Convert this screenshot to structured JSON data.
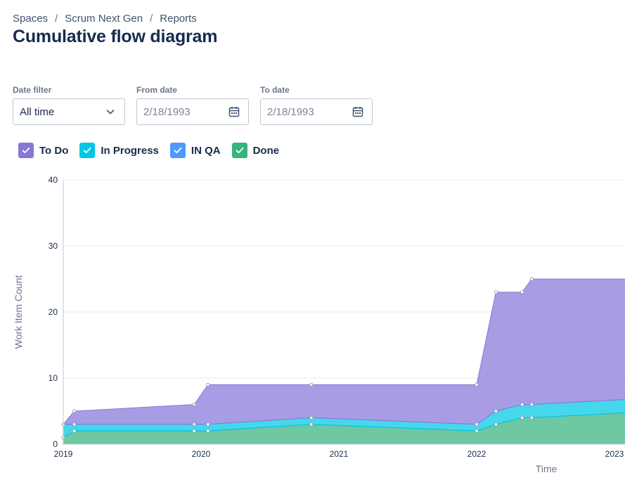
{
  "breadcrumb": {
    "items": [
      "Spaces",
      "Scrum Next Gen",
      "Reports"
    ],
    "separator": "/"
  },
  "page": {
    "title": "Cumulative flow diagram"
  },
  "filters": {
    "date_filter": {
      "label": "Date filter",
      "value": "All time"
    },
    "from_date": {
      "label": "From date",
      "value": "2/18/1993"
    },
    "to_date": {
      "label": "To date",
      "value": "2/18/1993"
    }
  },
  "legend": [
    {
      "label": "To Do",
      "color": "#8777d9",
      "checked": true
    },
    {
      "label": "In Progress",
      "color": "#00c7e6",
      "checked": true
    },
    {
      "label": "IN QA",
      "color": "#4c9aff",
      "checked": true
    },
    {
      "label": "Done",
      "color": "#36b37e",
      "checked": true
    }
  ],
  "chart_data": {
    "type": "area",
    "stacked": true,
    "xlabel": "Time",
    "ylabel": "Work Item Count",
    "ylim": [
      0,
      40
    ],
    "y_ticks": [
      0,
      10,
      20,
      30,
      40
    ],
    "x_ticks": [
      "2019",
      "2020",
      "2021",
      "2022",
      "2023"
    ],
    "grid": true,
    "x": [
      2019.0,
      2019.08,
      2019.95,
      2020.05,
      2020.8,
      2022.0,
      2022.14,
      2022.33,
      2022.4,
      2023.3
    ],
    "series": [
      {
        "name": "Done",
        "color": "#36b37e",
        "values": [
          1,
          2,
          2,
          2,
          3,
          2,
          3,
          4,
          4,
          5
        ]
      },
      {
        "name": "IN QA",
        "color": "#4c9aff",
        "values": [
          0,
          0,
          0,
          0,
          0,
          0,
          0,
          0,
          0,
          0
        ]
      },
      {
        "name": "In Progress",
        "color": "#00c7e6",
        "values": [
          2,
          1,
          1,
          1,
          1,
          1,
          2,
          2,
          2,
          2
        ]
      },
      {
        "name": "To Do",
        "color": "#8777d9",
        "values": [
          0,
          2,
          3,
          6,
          5,
          6,
          18,
          17,
          19,
          18
        ]
      }
    ]
  }
}
